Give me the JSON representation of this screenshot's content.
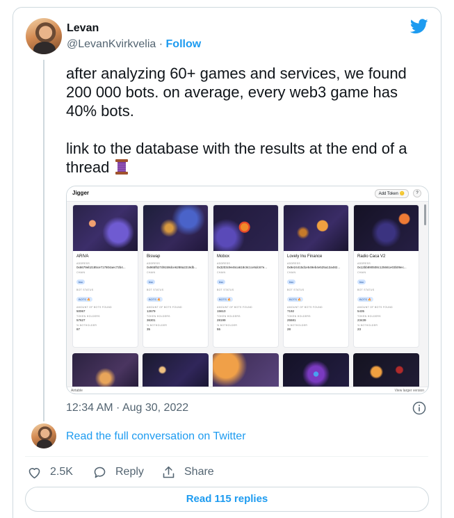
{
  "author": {
    "name": "Levan",
    "handle": "@LevanKvirkvelia",
    "separator": "·",
    "follow_label": "Follow"
  },
  "tweet": {
    "text": "after analyzing 60+ games and services, we found 200 000 bots. on average, every web3 game has 40% bots.\n\nlink to the database with the results at the end of a thread",
    "emoji_icon": "spool-of-thread-icon",
    "timestamp": "12:34 AM · Aug 30, 2022"
  },
  "media": {
    "app_name": "Jigger",
    "add_token_label": "Add Token 🪙",
    "help_label": "?",
    "labels": {
      "address": "ADDRESS",
      "chain": "CHAIN",
      "bot_status": "BOT STATUS",
      "bots_found": "AMOUNT OF BOTS FOUND",
      "holders": "TOKEN HOLDERS",
      "botholder": "% BOTHOLDER"
    },
    "cards": [
      {
        "name": "ARIVA",
        "address": "0x6679eb2185ce717804aec72b4...",
        "chain": "bsc",
        "status": "BOTS 🔥",
        "bots": "50067",
        "holders": "57627",
        "pct": "87"
      },
      {
        "name": "Biswap",
        "address": "0x965f527d9159dce6288a2219db...",
        "chain": "bsc",
        "status": "BOTS 🔥",
        "bots": "12679",
        "holders": "36301",
        "pct": "35"
      },
      {
        "name": "Mobox",
        "address": "0x3203c9e46ca618c8c1ce5dc67e...",
        "chain": "bsc",
        "status": "BOTS 🔥",
        "bots": "15610",
        "holders": "28199",
        "pct": "55"
      },
      {
        "name": "Lovely Inu Finance",
        "address": "0x9e24415d1e549eb4e525a13a482...",
        "chain": "bsc",
        "status": "BOTS 🔥",
        "bots": "7192",
        "holders": "25581",
        "pct": "28"
      },
      {
        "name": "Radio Caca V2",
        "address": "0x12bb890508c125661e03b09ec...",
        "chain": "bsc",
        "status": "BOTS 🔥",
        "bots": "5435",
        "holders": "23439",
        "pct": "23"
      }
    ],
    "footer_left": "Airtable",
    "footer_right": "View larger version"
  },
  "links": {
    "read_conversation": "Read the full conversation on Twitter",
    "read_replies": "Read 115 replies"
  },
  "actions": {
    "like_count": "2.5K",
    "reply_label": "Reply",
    "share_label": "Share"
  },
  "colors": {
    "accent": "#1d9bf0",
    "secondary_text": "#536471",
    "border": "#cfd9de"
  }
}
